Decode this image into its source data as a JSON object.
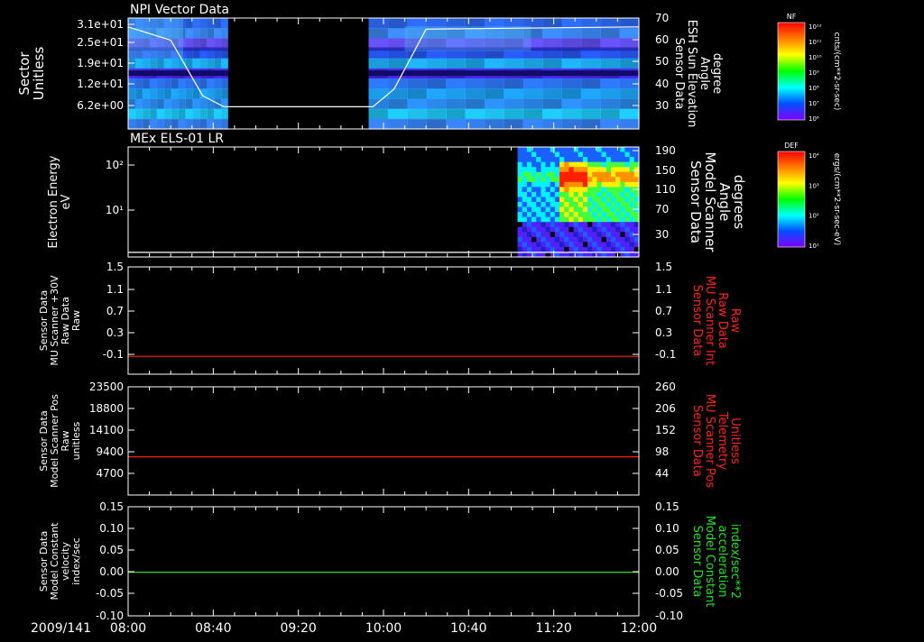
{
  "date_label": "2009/141",
  "time_ticks": [
    "08:00",
    "08:40",
    "09:20",
    "10:00",
    "10:40",
    "11:20",
    "12:00"
  ],
  "colorbars": [
    {
      "title": "NF",
      "units": "cnts/(cm**2-sr-sec)",
      "labels": [
        "10¹²",
        "10¹¹",
        "10¹⁰",
        "10⁹",
        "10⁸",
        "10⁷",
        "10⁶"
      ],
      "colors": [
        "#ff0000",
        "#ff7f00",
        "#ffff00",
        "#00ff00",
        "#00ffff",
        "#0060ff",
        "#8000ff"
      ]
    },
    {
      "title": "DEF",
      "units": "ergs/(cm**2-sr-sec-eV)",
      "labels": [
        "10⁴",
        "10³",
        "10²",
        "10¹"
      ],
      "colors": [
        "#ff0000",
        "#ff7f00",
        "#ffff00",
        "#00ff00",
        "#00ffff",
        "#0060ff",
        "#8000ff"
      ]
    }
  ],
  "chart_data": [
    {
      "type": "heatmap",
      "title": "NPI Vector Data",
      "ylabel": [
        "Sector",
        "Unitless"
      ],
      "yticks": [
        "3.1e+01",
        "2.5e+01",
        "1.9e+01",
        "1.2e+01",
        "6.2e+00"
      ],
      "y2label": [
        "Sensor Data",
        "ESH Sun Elevation",
        "Angle",
        "degree"
      ],
      "y2ticks": [
        "70",
        "60",
        "50",
        "40",
        "30"
      ],
      "ylim2": [
        20,
        70
      ],
      "data_gap": [
        "08:47",
        "09:53"
      ],
      "line_series": {
        "name": "ESH Sun Elevation Angle",
        "color": "#ffffff",
        "x": [
          "08:00",
          "08:20",
          "08:35",
          "08:45",
          "09:55",
          "10:05",
          "10:20",
          "12:00"
        ],
        "y": [
          66,
          60,
          35,
          30,
          30,
          38,
          65,
          66
        ]
      }
    },
    {
      "type": "heatmap",
      "title": "MEx ELS-01 LR",
      "ylabel": [
        "Electron Energy",
        "eV"
      ],
      "yticks": [
        "10²",
        "10¹"
      ],
      "y2label": [
        "Sensor Data",
        "Model Scanner",
        "Angle",
        "degrees"
      ],
      "y2ticks": [
        "190",
        "150",
        "110",
        "70",
        "30"
      ],
      "ylim2": [
        0,
        190
      ],
      "data_start": "11:03",
      "line_series": {
        "name": "Model Scanner Angle",
        "color": "#ffffff",
        "x": [
          "08:00",
          "12:00"
        ],
        "y": [
          8,
          8
        ]
      }
    },
    {
      "type": "line",
      "ylabel": [
        "Sensor Data",
        "MU Scanner +30V",
        "Raw Data",
        "Raw"
      ],
      "yticks": [
        "1.5",
        "1.1",
        "0.7",
        "0.3",
        "-0.1"
      ],
      "ylim": [
        -0.3,
        1.5
      ],
      "y2label": [
        "Sensor Data",
        "MU Scanner Int",
        "Raw Data",
        "Raw"
      ],
      "y2ticks": [
        "1.5",
        "1.1",
        "0.7",
        "0.3",
        "-0.1"
      ],
      "y2color": "#ff2020",
      "series": [
        {
          "color": "#ff2020",
          "x": [
            "08:00",
            "12:00"
          ],
          "y": [
            0.0,
            0.0
          ]
        }
      ]
    },
    {
      "type": "line",
      "ylabel": [
        "Sensor Data",
        "Model Scanner Pos",
        "Raw",
        "unitless"
      ],
      "yticks": [
        "23500",
        "18800",
        "14100",
        "9400",
        "4700"
      ],
      "ylim": [
        0,
        23500
      ],
      "y2label": [
        "Sensor Data",
        "MU Scanner Pos",
        "Telemetry",
        "Unitless"
      ],
      "y2ticks": [
        "260",
        "206",
        "152",
        "98",
        "44"
      ],
      "y2color": "#ff2020",
      "series": [
        {
          "color": "#ff2020",
          "x": [
            "08:00",
            "12:00"
          ],
          "y": [
            8300,
            8300
          ]
        }
      ]
    },
    {
      "type": "line",
      "ylabel": [
        "Sensor Data",
        "Model Constant",
        "velocity",
        "index/sec"
      ],
      "yticks": [
        "0.15",
        "0.10",
        "0.05",
        "0.00",
        "-0.05",
        "-0.10"
      ],
      "ylim": [
        -0.1,
        0.15
      ],
      "y2label": [
        "Sensor Data",
        "Model Constant",
        "acceleration",
        "index/sec**2"
      ],
      "y2ticks": [
        "0.15",
        "0.10",
        "0.05",
        "0.00",
        "-0.05",
        "-0.10"
      ],
      "y2color": "#20e020",
      "series": [
        {
          "color": "#20e020",
          "x": [
            "08:00",
            "12:00"
          ],
          "y": [
            0.0,
            0.0
          ]
        }
      ]
    }
  ]
}
